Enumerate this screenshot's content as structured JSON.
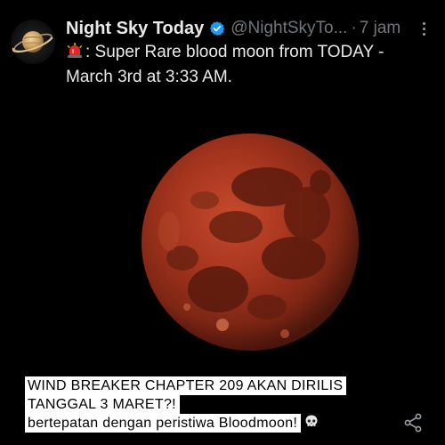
{
  "post": {
    "display_name": "Night Sky Today",
    "handle": "@NightSkyTo...",
    "separator": "·",
    "timestamp": "7 jam",
    "text": ": Super Rare blood moon from TODAY - March 3rd at 3:33 AM.",
    "text_prefix_icon": "siren-emoji",
    "avatar_icon": "saturn-icon",
    "verified_icon": "verified-badge-icon",
    "menu_icon": "more-vertical-icon"
  },
  "media": {
    "image_subject": "blood-moon",
    "caption_lines": [
      "WIND BREAKER CHAPTER 209 AKAN DIRILIS",
      "TANGGAL 3 MARET?!",
      "bertepatan dengan peristiwa Bloodmoon!"
    ],
    "caption_suffix_icon": "skull-emoji"
  },
  "actions": {
    "share_icon": "share-icon"
  },
  "colors": {
    "background": "#000000",
    "text_primary": "#e7e9ea",
    "text_secondary": "#71767b",
    "verified": "#1d9bf0",
    "moon": "#a8321c"
  }
}
